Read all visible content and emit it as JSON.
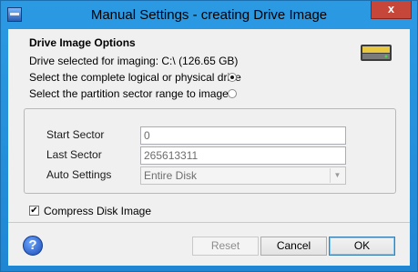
{
  "window": {
    "title": "Manual Settings - creating Drive Image",
    "close_label": "x"
  },
  "options": {
    "heading": "Drive Image Options",
    "drive_selected": "Drive selected for imaging: C:\\ (126.65 GB)",
    "radio_whole": "Select the complete logical or physical drive",
    "radio_whole_checked": true,
    "radio_range": "Select the partition sector range to image",
    "radio_range_checked": false
  },
  "sectors": {
    "start_label": "Start Sector",
    "start_value": "0",
    "last_label": "Last Sector",
    "last_value": "265613311",
    "auto_label": "Auto Settings",
    "auto_value": "Entire Disk"
  },
  "compress": {
    "label": "Compress Disk Image",
    "checked": true,
    "check_glyph": "✔"
  },
  "buttons": {
    "help_glyph": "?",
    "reset": "Reset",
    "cancel": "Cancel",
    "ok": "OK"
  }
}
